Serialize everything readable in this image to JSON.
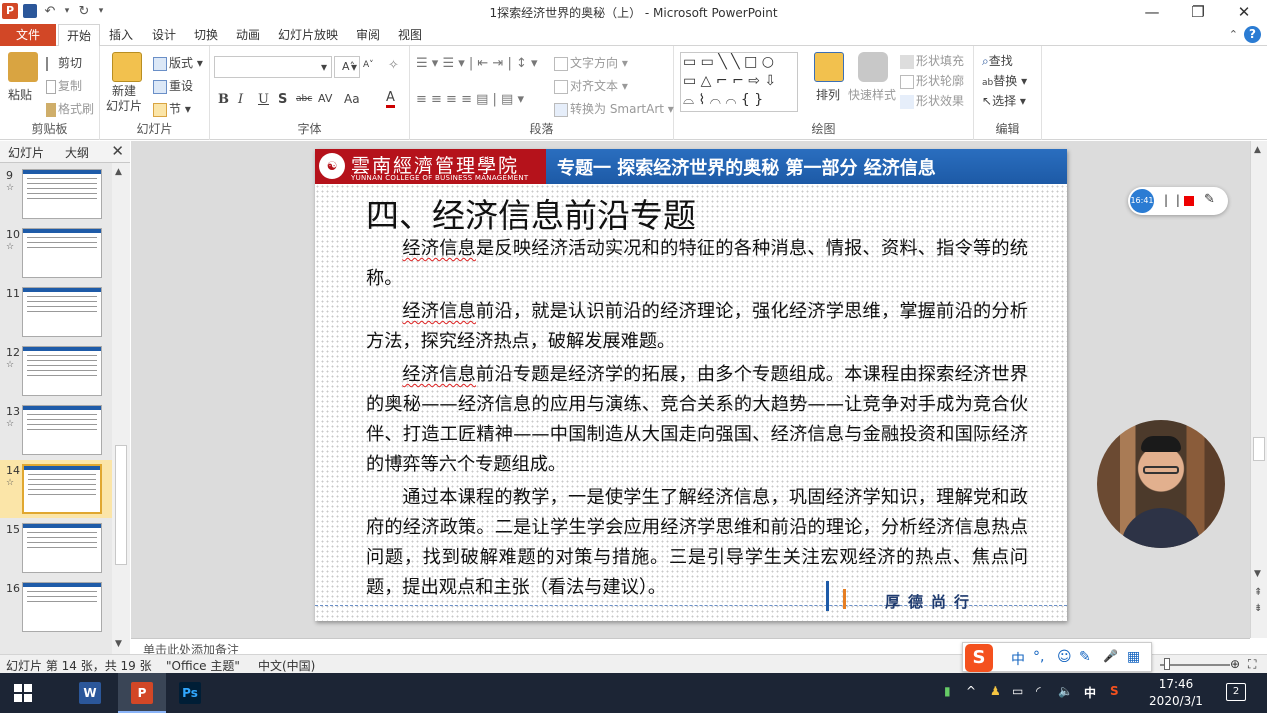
{
  "window": {
    "title": "1探索经济世界的奥秘（上） - Microsoft PowerPoint",
    "minimize": "—",
    "restore": "❐",
    "close": "✕",
    "qat_undo": "↶",
    "qat_undo_dropdown": "▾",
    "qat_redo": "↻",
    "qat_customize": "▾"
  },
  "ribbon_tabs": {
    "file": "文件",
    "tabs": [
      "开始",
      "插入",
      "设计",
      "切换",
      "动画",
      "幻灯片放映",
      "审阅",
      "视图"
    ],
    "collapse": "⌃",
    "help": "?"
  },
  "ribbon": {
    "clipboard": {
      "label": "剪贴板",
      "paste": "粘贴",
      "cut": "剪切",
      "copy": "复制",
      "format_painter": "格式刷"
    },
    "slides": {
      "label": "幻灯片",
      "new_slide": "新建\n幻灯片",
      "layout": "版式",
      "reset": "重设",
      "section": "节"
    },
    "font": {
      "label": "字体",
      "bold": "B",
      "italic": "I",
      "underline": "U",
      "shadow": "S",
      "strike": "abc",
      "spacing": "AV",
      "case": "Aa",
      "color": "A",
      "grow": "A˄",
      "shrink": "A˅",
      "clear": "✧"
    },
    "paragraph": {
      "label": "段落",
      "text_direction": "文字方向",
      "align_text": "对齐文本",
      "smartart": "转换为 SmartArt"
    },
    "drawing": {
      "label": "绘图",
      "arrange": "排列",
      "quick_styles": "快速样式",
      "shape_fill": "形状填充",
      "shape_outline": "形状轮廓",
      "shape_effects": "形状效果"
    },
    "editing": {
      "label": "编辑",
      "find": "查找",
      "replace": "替换",
      "select": "选择"
    }
  },
  "left_pane": {
    "tab_slides": "幻灯片",
    "tab_outline": "大纲",
    "close": "✕",
    "thumbnails": [
      {
        "num": "9",
        "star": "☆"
      },
      {
        "num": "10",
        "star": "☆"
      },
      {
        "num": "11",
        "star": ""
      },
      {
        "num": "12",
        "star": "☆"
      },
      {
        "num": "13",
        "star": "☆"
      },
      {
        "num": "14",
        "star": "☆"
      },
      {
        "num": "15",
        "star": ""
      },
      {
        "num": "16",
        "star": ""
      }
    ]
  },
  "slide": {
    "college_name": "雲南經濟管理學院",
    "college_en": "YUNNAN COLLEGE OF BUSINESS MANAGEMENT",
    "header": "专题一 探索经济世界的奥秘 第一部分 经济信息",
    "title": "四、经济信息前沿专题",
    "p1_u": "经济信息",
    "p1": "是反映经济活动实况和的特征的各种消息、情报、资料、指令等的统称。",
    "p2_u": "经济信息",
    "p2": "前沿，就是认识前沿的经济理论，强化经济学思维，掌握前沿的分析方法，探究经济热点，破解发展难题。",
    "p3_u": "经济信息",
    "p3": "前沿专题是经济学的拓展，由多个专题组成。本课程由探索经济世界的奥秘——经济信息的应用与演练、竞合关系的大趋势——让竞争对手成为竞合伙伴、打造工匠精神——中国制造从大国走向强国、经济信息与金融投资和国际经济的博弈等六个专题组成。",
    "p4": "通过本课程的教学，一是使学生了解经济信息，巩固经济学知识，理解党和政府的经济政策。二是让学生学会应用经济学思维和前沿的理论，分析经济信息热点问题，找到破解难题的对策与措施。三是引导学生关注宏观经济的热点、焦点问题，提出观点和主张（看法与建议）。",
    "motto": "厚德尚行"
  },
  "recorder": {
    "time": "16:41",
    "pause": "| |",
    "pen": "✎"
  },
  "notes": {
    "placeholder": "单击此处添加备注"
  },
  "status": {
    "slide_info": "幻灯片 第 14 张，共 19 张",
    "theme": "\"Office 主题\"",
    "language": "中文(中国)"
  },
  "ime": {
    "logo": "S",
    "items": [
      "中",
      "°,",
      "☺",
      "✎",
      "🎤",
      "▦"
    ]
  },
  "taskbar": {
    "apps": [
      {
        "name": "word",
        "label": "W",
        "color": "#2b579a"
      },
      {
        "name": "powerpoint",
        "label": "P",
        "color": "#d24726"
      },
      {
        "name": "photoshop",
        "label": "Ps",
        "color": "#001e36"
      }
    ],
    "tray": {
      "lang": "中",
      "time": "17:46",
      "date": "2020/3/1",
      "notif_count": "2"
    }
  }
}
